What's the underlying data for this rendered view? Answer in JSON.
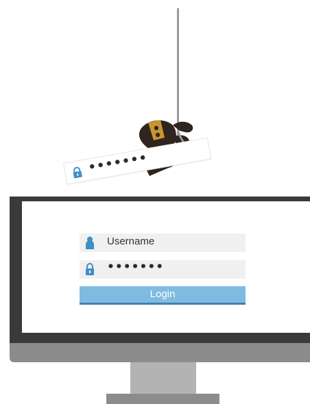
{
  "stolen_credential": {
    "password_mask": "•••••••",
    "icon": "lock-icon"
  },
  "login_form": {
    "username_label": "Username",
    "username_icon": "user-icon",
    "password_mask": "•••••••",
    "password_icon": "lock-icon",
    "login_label": "Login"
  },
  "colors": {
    "accent": "#7fbbe0",
    "accent_dark": "#3f7fb3",
    "icon_blue": "#3f8fc8",
    "ninja": "#2f241e",
    "ninja_band": "#c9962e",
    "monitor_bezel": "#3a3a3a",
    "monitor_stand": "#8c8c8c"
  }
}
